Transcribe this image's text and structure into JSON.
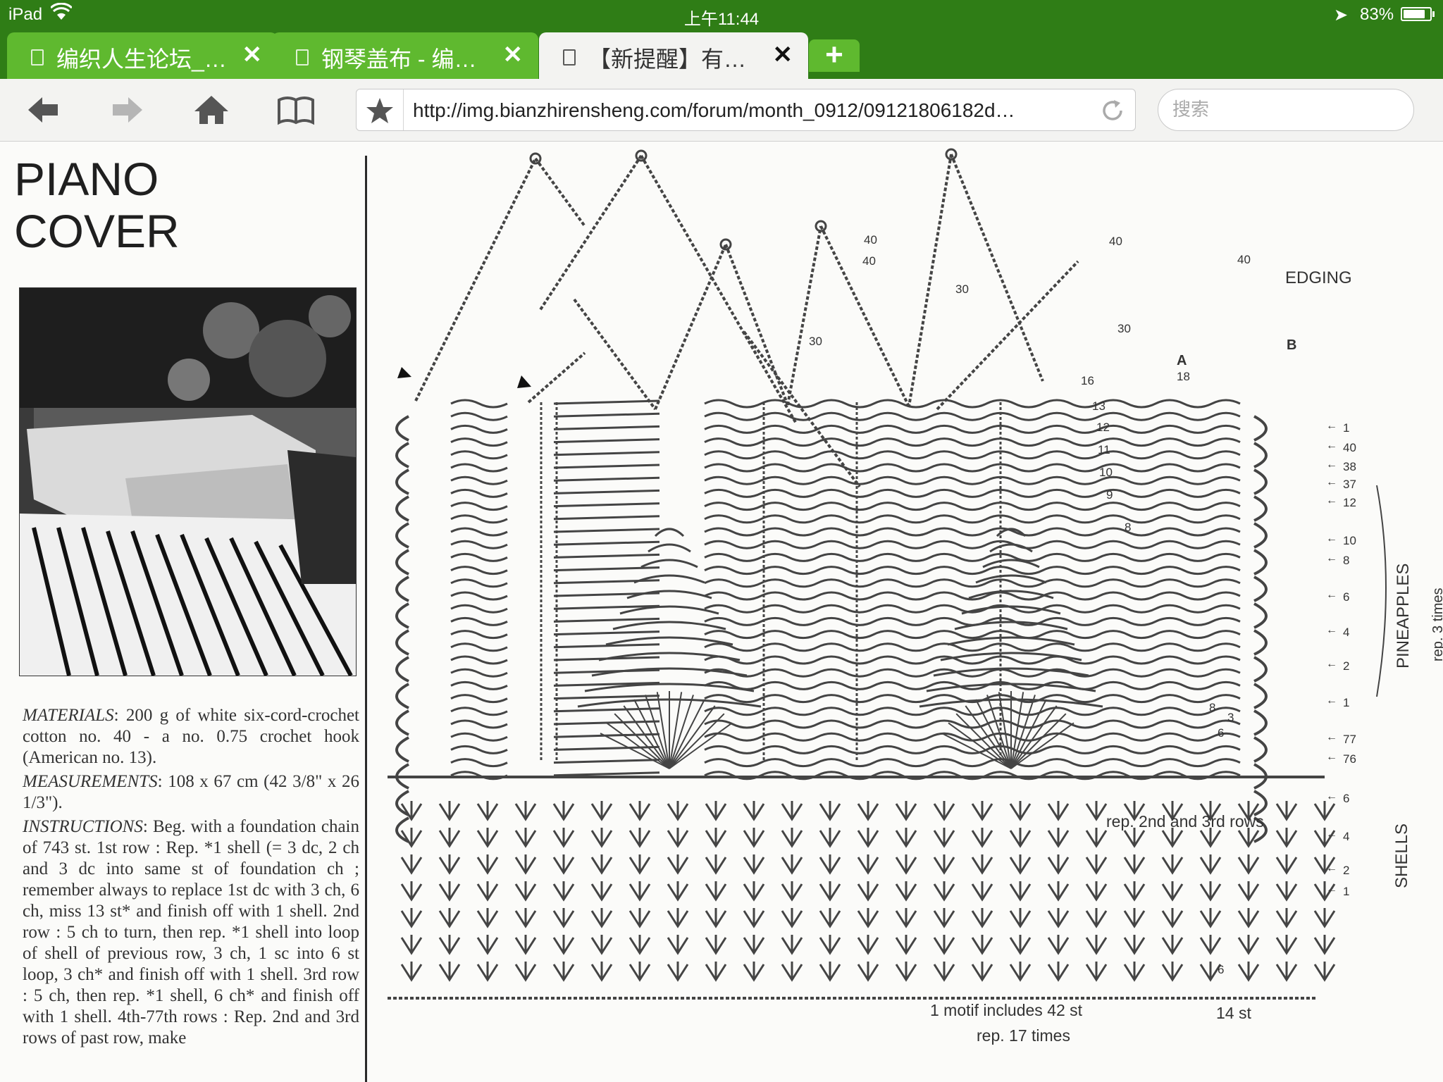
{
  "status": {
    "device": "iPad",
    "time": "上午11:44",
    "battery": "83%",
    "battery_level": 0.83
  },
  "tabs": [
    {
      "label": "编织人生论坛_…",
      "active": false
    },
    {
      "label": "钢琴盖布 - 编…",
      "active": false
    },
    {
      "label": "【新提醒】有…",
      "active": true
    }
  ],
  "toolbar": {
    "url": "http://img.bianzhirensheng.com/forum/month_0912/09121806182d…",
    "search_placeholder": "搜索"
  },
  "page": {
    "title_line1": "PIANO",
    "title_line2": "COVER",
    "materials_label": "MATERIALS",
    "materials_text": ": 200 g of white six-cord-crochet cotton no. 40 - a no. 0.75 crochet hook (American no. 13).",
    "measurements_label": "MEASUREMENTS",
    "measurements_text": ": 108 x 67 cm (42 3/8\" x 26 1/3\").",
    "instructions_label": "INSTRUCTIONS",
    "instructions_text": ": Beg. with a foundation chain of 743 st. 1st row : Rep. *1 shell (= 3 dc, 2 ch and 3 dc into same st of foundation ch ; remember always to replace 1st dc with 3 ch, 6 ch, miss 13 st* and finish off with 1 shell. 2nd row : 5 ch to turn, then rep. *1 shell into loop of shell of previous row, 3 ch, 1 sc into 6 st loop, 3 ch* and finish off with 1 shell. 3rd row : 5 ch, then rep. *1 shell, 6 ch* and finish off with 1 shell. 4th-77th rows : Rep. 2nd and 3rd rows of past row, make"
  },
  "diagram": {
    "edging": "EDGING",
    "pineapples": "PINEAPPLES",
    "shells": "SHELLS",
    "rep3": "rep. 3 times",
    "rep23": "rep. 2nd and 3rd rows",
    "motif": "1 motif includes 42 st",
    "rep17": "rep. 17 times",
    "st14": "14 st",
    "mark_a": "A",
    "mark_b": "B",
    "right_rows": [
      "1",
      "40",
      "38",
      "37",
      "12",
      "10",
      "8",
      "6",
      "4",
      "2",
      "1",
      "77",
      "76",
      "6",
      "4",
      "2",
      "1"
    ],
    "num_40": "40",
    "num_30": "30",
    "num_16": "16",
    "num_18": "18",
    "num_13": "13",
    "num_12": "12",
    "num_11": "11",
    "num_10": "10",
    "num_9": "9",
    "num_8": "8",
    "num_6": "6",
    "num_3": "3"
  }
}
